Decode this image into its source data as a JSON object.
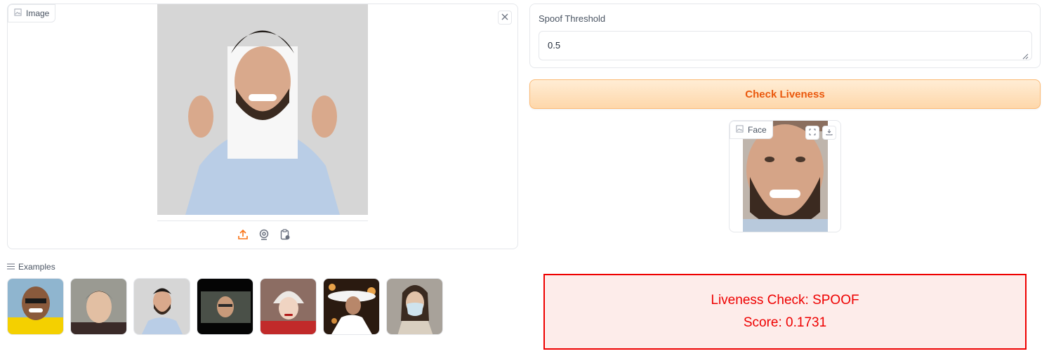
{
  "image_panel": {
    "label": "Image",
    "label_icon": "image-icon",
    "close_icon": "close-icon",
    "toolbar": [
      {
        "name": "upload-icon",
        "color": "#f97316"
      },
      {
        "name": "webcam-icon",
        "color": "#6b7280"
      },
      {
        "name": "clipboard-icon",
        "color": "#6b7280"
      }
    ]
  },
  "threshold": {
    "label": "Spoof Threshold",
    "value": "0.5"
  },
  "check_button": {
    "label": "Check Liveness",
    "color": "#ea580c"
  },
  "face_panel": {
    "label": "Face",
    "label_icon": "image-icon",
    "buttons": [
      "fullscreen-icon",
      "download-icon"
    ]
  },
  "examples": {
    "label": "Examples",
    "icon": "list-icon",
    "count": 7
  },
  "result": {
    "line1": "Liveness Check: SPOOF",
    "line2": "Score: 0.1731",
    "border_color": "#ee0000",
    "background": "#fdecea"
  }
}
